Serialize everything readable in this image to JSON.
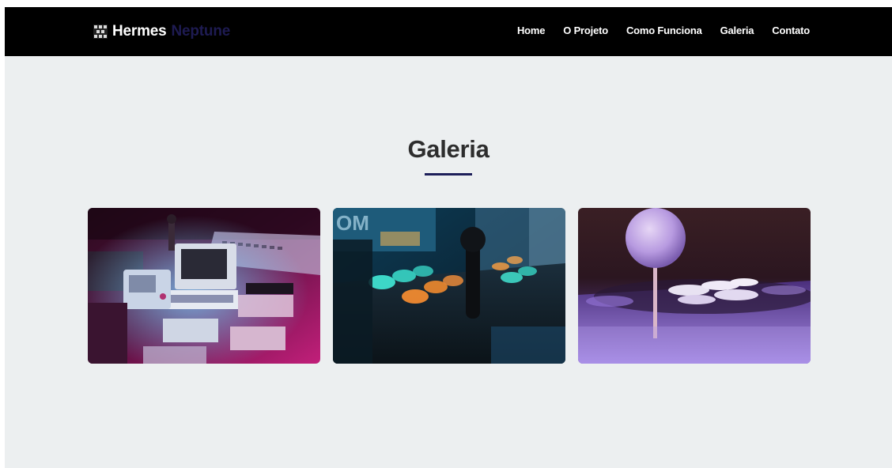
{
  "brand": {
    "name": "Hermes",
    "accent": "Neptune",
    "accent_color": "#1e1b52"
  },
  "nav": {
    "items": [
      "Home",
      "O Projeto",
      "Como Funciona",
      "Galeria",
      "Contato"
    ]
  },
  "gallery": {
    "title": "Galeria",
    "underline_color": "#1d1f5a",
    "images": [
      {
        "name": "retro-consoles-photo"
      },
      {
        "name": "arcade-buttons-photo"
      },
      {
        "name": "arcade-joystick-photo"
      }
    ]
  },
  "colors": {
    "navbar": "#000000",
    "page_bg": "#eceff0",
    "title": "#2d2d2d"
  }
}
